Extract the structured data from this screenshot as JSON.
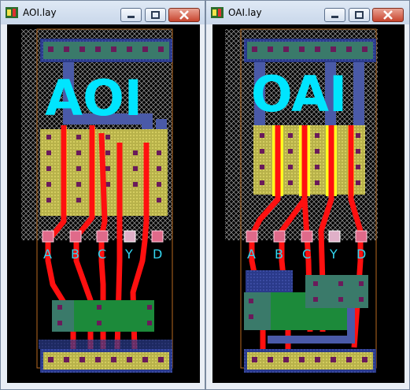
{
  "windows": [
    {
      "title": "AOI.lay",
      "big_label": "AOI",
      "pins": [
        "A",
        "B",
        "C",
        "Y",
        "D"
      ],
      "buttons": {
        "minimize": "minimize",
        "maximize": "maximize",
        "close": "close"
      }
    },
    {
      "title": "OAI.lay",
      "big_label": "OAI",
      "pins": [
        "A",
        "B",
        "C",
        "Y",
        "D"
      ],
      "buttons": {
        "minimize": "minimize",
        "maximize": "maximize",
        "close": "close"
      }
    }
  ],
  "colors": {
    "canvas": "#000000",
    "label": "#00e5ff",
    "metal_red": "#ff1010",
    "poly_yellow": "#ffff20",
    "diffusion_green": "#1c8a3a",
    "well_grey": "#8a8a8a",
    "contact": "#6a1a5a"
  },
  "icons": [
    "layout-app-icon",
    "minimize-icon",
    "maximize-icon",
    "close-icon"
  ]
}
